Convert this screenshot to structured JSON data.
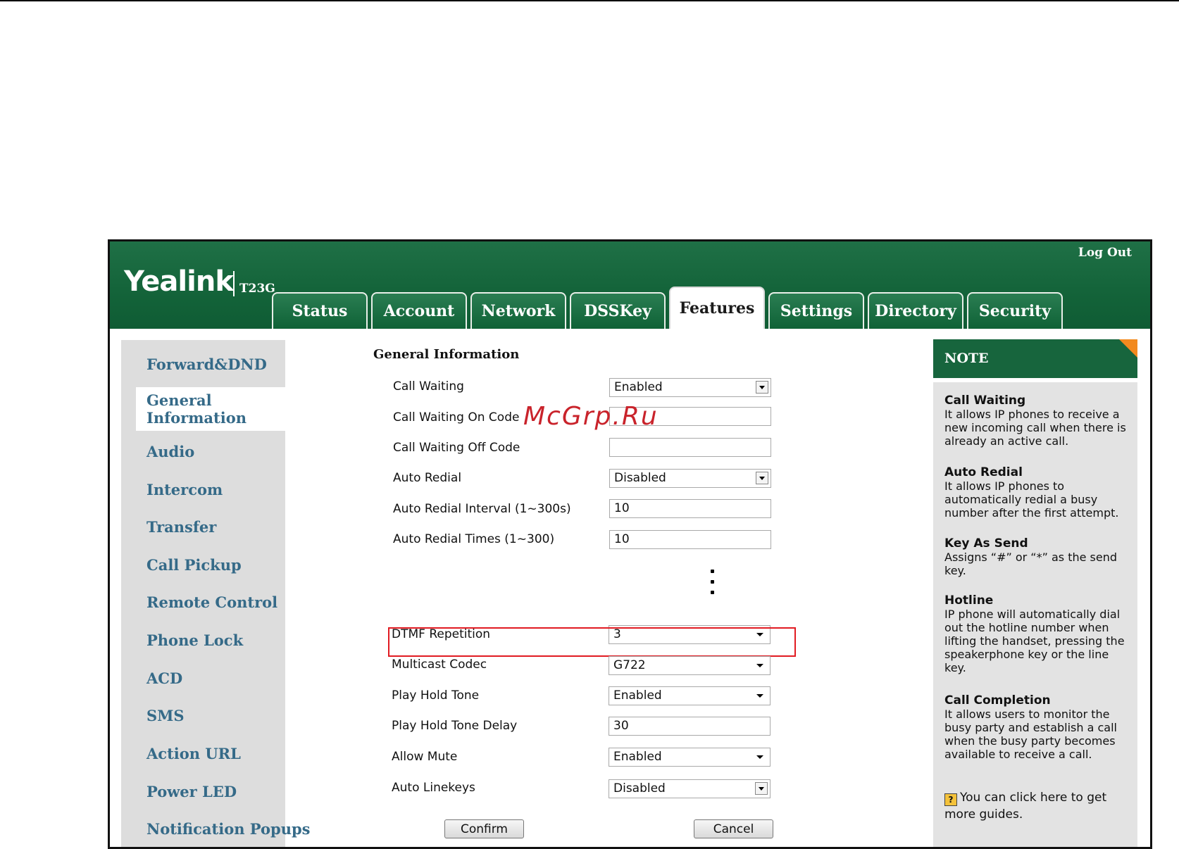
{
  "header": {
    "logo": "Yealink",
    "model": "T23G",
    "logout_label": "Log Out"
  },
  "tabs": [
    {
      "label": "Status"
    },
    {
      "label": "Account"
    },
    {
      "label": "Network"
    },
    {
      "label": "DSSKey"
    },
    {
      "label": "Features",
      "active": true
    },
    {
      "label": "Settings"
    },
    {
      "label": "Directory"
    },
    {
      "label": "Security"
    }
  ],
  "sidebar": {
    "items": [
      {
        "label": "Forward&DND"
      },
      {
        "label": "General Information",
        "active": true
      },
      {
        "label": "Audio"
      },
      {
        "label": "Intercom"
      },
      {
        "label": "Transfer"
      },
      {
        "label": "Call Pickup"
      },
      {
        "label": "Remote Control"
      },
      {
        "label": "Phone Lock"
      },
      {
        "label": "ACD"
      },
      {
        "label": "SMS"
      },
      {
        "label": "Action URL"
      },
      {
        "label": "Power LED"
      },
      {
        "label": "Notification Popups"
      }
    ]
  },
  "form": {
    "title": "General Information",
    "fields": [
      {
        "label": "Call Waiting",
        "value": "Enabled",
        "type": "select"
      },
      {
        "label": "Call Waiting On Code",
        "value": "",
        "type": "text"
      },
      {
        "label": "Call Waiting Off Code",
        "value": "",
        "type": "text"
      },
      {
        "label": "Auto Redial",
        "value": "Disabled",
        "type": "select"
      },
      {
        "label": "Auto Redial Interval (1~300s)",
        "value": "10",
        "type": "text"
      },
      {
        "label": "Auto Redial Times (1~300)",
        "value": "10",
        "type": "text"
      },
      {
        "label": "DTMF Repetition",
        "value": "3",
        "type": "select"
      },
      {
        "label": "Multicast Codec",
        "value": "G722",
        "type": "select"
      },
      {
        "label": "Play Hold Tone",
        "value": "Enabled",
        "type": "select"
      },
      {
        "label": "Play Hold Tone Delay",
        "value": "30",
        "type": "text"
      },
      {
        "label": "Allow Mute",
        "value": "Enabled",
        "type": "select"
      },
      {
        "label": "Auto Linekeys",
        "value": "Disabled",
        "type": "select"
      }
    ],
    "confirm_label": "Confirm",
    "cancel_label": "Cancel"
  },
  "note": {
    "title": "NOTE",
    "sections": [
      {
        "title": "Call Waiting",
        "text": "It allows IP phones to receive a new incoming call when there is already an active call."
      },
      {
        "title": "Auto Redial",
        "text": "It allows IP phones to automatically redial a busy number after the first attempt."
      },
      {
        "title": "Key As Send",
        "text": "Assigns “#” or “*” as the send key."
      },
      {
        "title": "Hotline",
        "text": "IP phone will automatically dial out the hotline number when lifting the handset, pressing the speakerphone key or the line key."
      },
      {
        "title": "Call Completion",
        "text": "It allows users to monitor the busy party and establish a call when the busy party becomes available to receive a call."
      }
    ],
    "guide_text": "You can click here to get more guides.",
    "guide_icon": "?"
  },
  "watermark": "McGrp.Ru",
  "colors": {
    "header_green": "#14643a",
    "sidebar_link": "#356a88",
    "highlight_red": "#e11b22",
    "note_corner": "#f28a1f"
  }
}
